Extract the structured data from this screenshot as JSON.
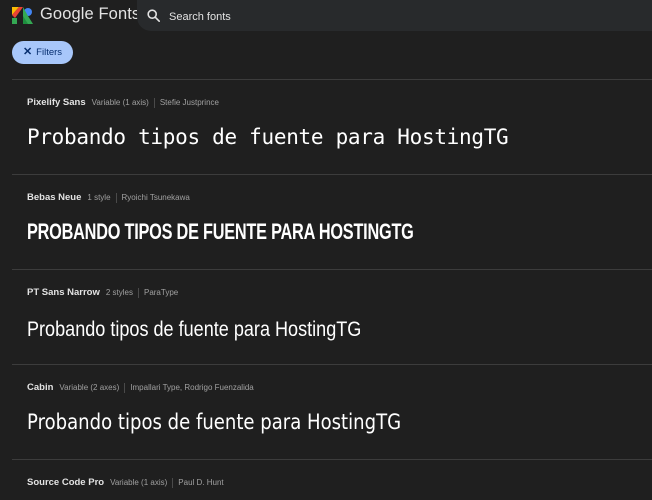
{
  "header": {
    "logo_text": "Google Fonts",
    "search_placeholder": "Search fonts"
  },
  "filters": {
    "label": "Filters"
  },
  "sample_text": "Probando tipos de fuente para HostingTG",
  "fonts": [
    {
      "name": "Pixelify Sans",
      "styles": "Variable (1 axis)",
      "designer": "Stefie Justprince",
      "sample": "Probando tipos de fuente para HostingTG"
    },
    {
      "name": "Bebas Neue",
      "styles": "1 style",
      "designer": "Ryoichi Tsunekawa",
      "sample": "Probando tipos de fuente para HostingTG"
    },
    {
      "name": "PT Sans Narrow",
      "styles": "2 styles",
      "designer": "ParaType",
      "sample": "Probando tipos de fuente para HostingTG"
    },
    {
      "name": "Cabin",
      "styles": "Variable (2 axes)",
      "designer": "Impallari Type, Rodrigo Fuenzalida",
      "sample": "Probando tipos de fuente para HostingTG"
    },
    {
      "name": "Source Code Pro",
      "styles": "Variable (1 axis)",
      "designer": "Paul D. Hunt"
    }
  ],
  "colors": {
    "background": "#1f1f1f",
    "search_bg": "#282a2c",
    "filter_chip": "#a8c7fa",
    "divider": "#3c3c3c"
  }
}
